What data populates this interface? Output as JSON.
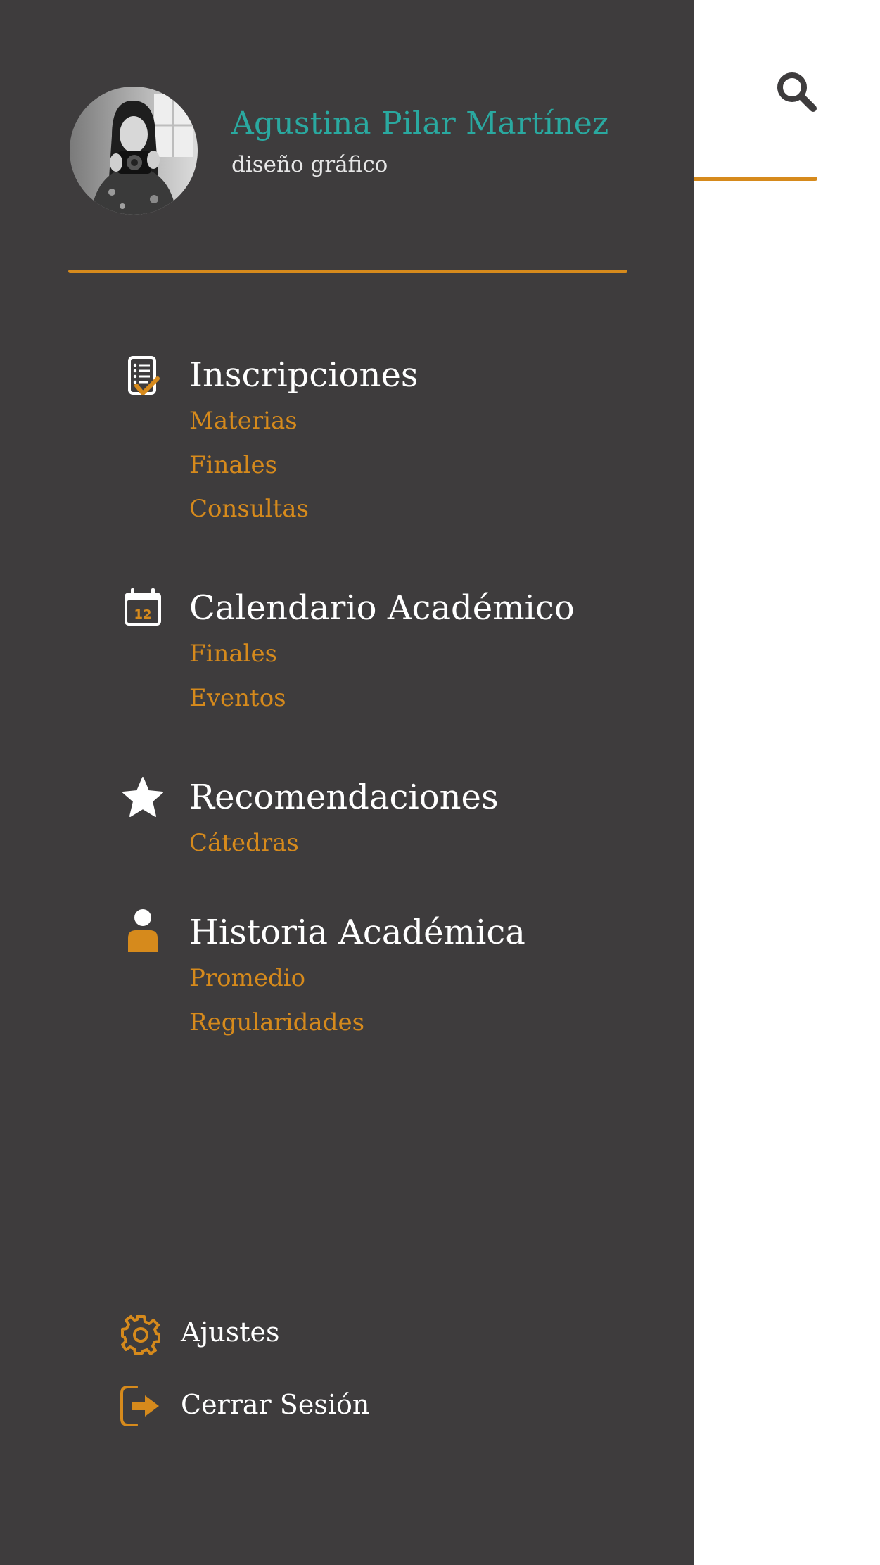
{
  "profile": {
    "name": "Agustina Pilar Martínez",
    "role": "diseño gráfico"
  },
  "icons": {
    "search": "search-icon",
    "inscripciones": "clipboard-check-icon",
    "calendario": "calendar-icon",
    "recomendaciones": "star-icon",
    "historia": "person-icon",
    "ajustes": "gear-icon",
    "cerrar_sesion": "logout-icon"
  },
  "calendar_icon_day": "12",
  "nav": {
    "inscripciones": {
      "title": "Inscripciones",
      "items": [
        "Materias",
        "Finales",
        "Consultas"
      ]
    },
    "calendario": {
      "title": "Calendario Académico",
      "items": [
        "Finales",
        "Eventos"
      ]
    },
    "recomendaciones": {
      "title": "Recomendaciones",
      "items": [
        "Cátedras"
      ]
    },
    "historia": {
      "title": "Historia Académica",
      "items": [
        "Promedio",
        "Regularidades"
      ]
    }
  },
  "footer": {
    "settings_label": "Ajustes",
    "logout_label": "Cerrar Sesión"
  },
  "colors": {
    "drawer_bg": "#3e3c3d",
    "accent": "#d68a1c",
    "name": "#2aa9a0",
    "text": "#ffffff"
  }
}
